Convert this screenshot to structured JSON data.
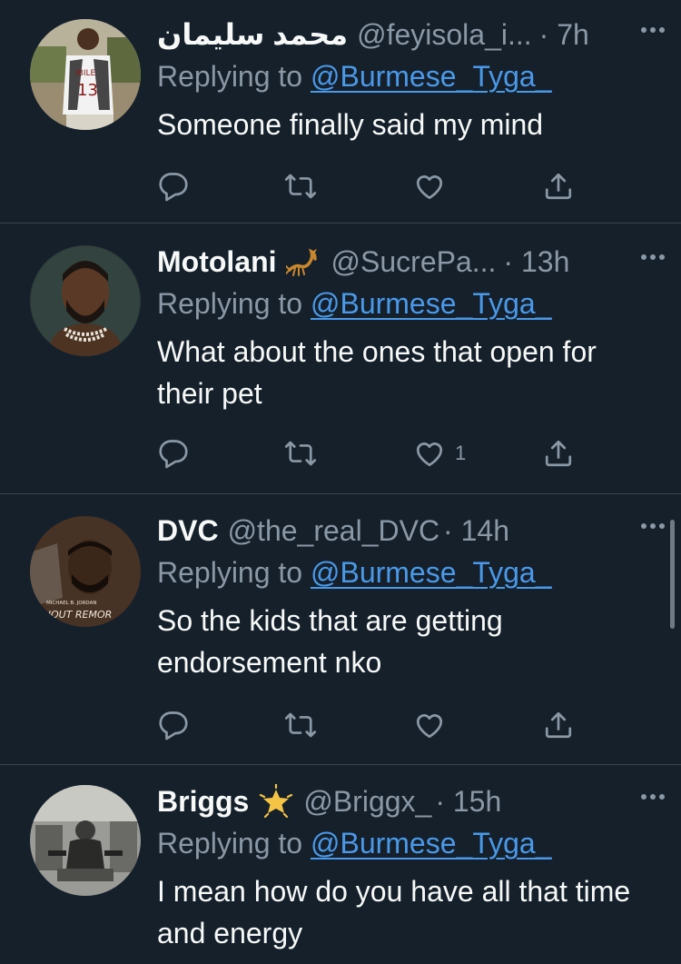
{
  "tweets": [
    {
      "name": "محمد سليمان",
      "handle": "@feyisola_i...",
      "time": "· 7h",
      "replying_prefix": "Replying to ",
      "replying_to": "@Burmese_Tyga_",
      "text": "Someone finally said my mind",
      "likes": "",
      "avatar_icon": "profile-photo-soccer-jersey-13",
      "avatar_jersey_text": "IBILE",
      "avatar_jersey_number": "13"
    },
    {
      "name": "Motolani",
      "name_emoji": "scorpion",
      "handle": "@SucrePa...",
      "time": "· 13h",
      "replying_prefix": "Replying to ",
      "replying_to": "@Burmese_Tyga_",
      "text": "What about the ones that open for their pet",
      "likes": "1",
      "avatar_icon": "profile-photo-man-pearl-necklace"
    },
    {
      "name": "DVC",
      "handle": "@the_real_DVC",
      "time": "· 14h",
      "replying_prefix": "Replying to ",
      "replying_to": "@Burmese_Tyga_",
      "text": "So the kids that are getting endorsement nko",
      "likes": "",
      "avatar_icon": "profile-photo-movie-poster",
      "avatar_poster_credit": "MICHAEL B. JORDAN",
      "avatar_poster_title": "THOUT REMOR"
    },
    {
      "name": "Briggs",
      "name_emoji": "glowing-star",
      "handle": "@Briggx_",
      "time": "· 15h",
      "replying_prefix": "Replying to ",
      "replying_to": "@Burmese_Tyga_",
      "text": "I mean how do you have all that time and energy",
      "likes": "",
      "avatar_icon": "profile-photo-gym"
    }
  ],
  "more_label": "•••",
  "icons": {
    "reply": "reply-icon",
    "retweet": "retweet-icon",
    "like": "like-icon",
    "share": "share-icon"
  },
  "colors": {
    "background": "#15202b",
    "text": "#f7f9f9",
    "secondary": "#8b98a5",
    "link": "#4a99e9",
    "divider": "#38444d"
  }
}
